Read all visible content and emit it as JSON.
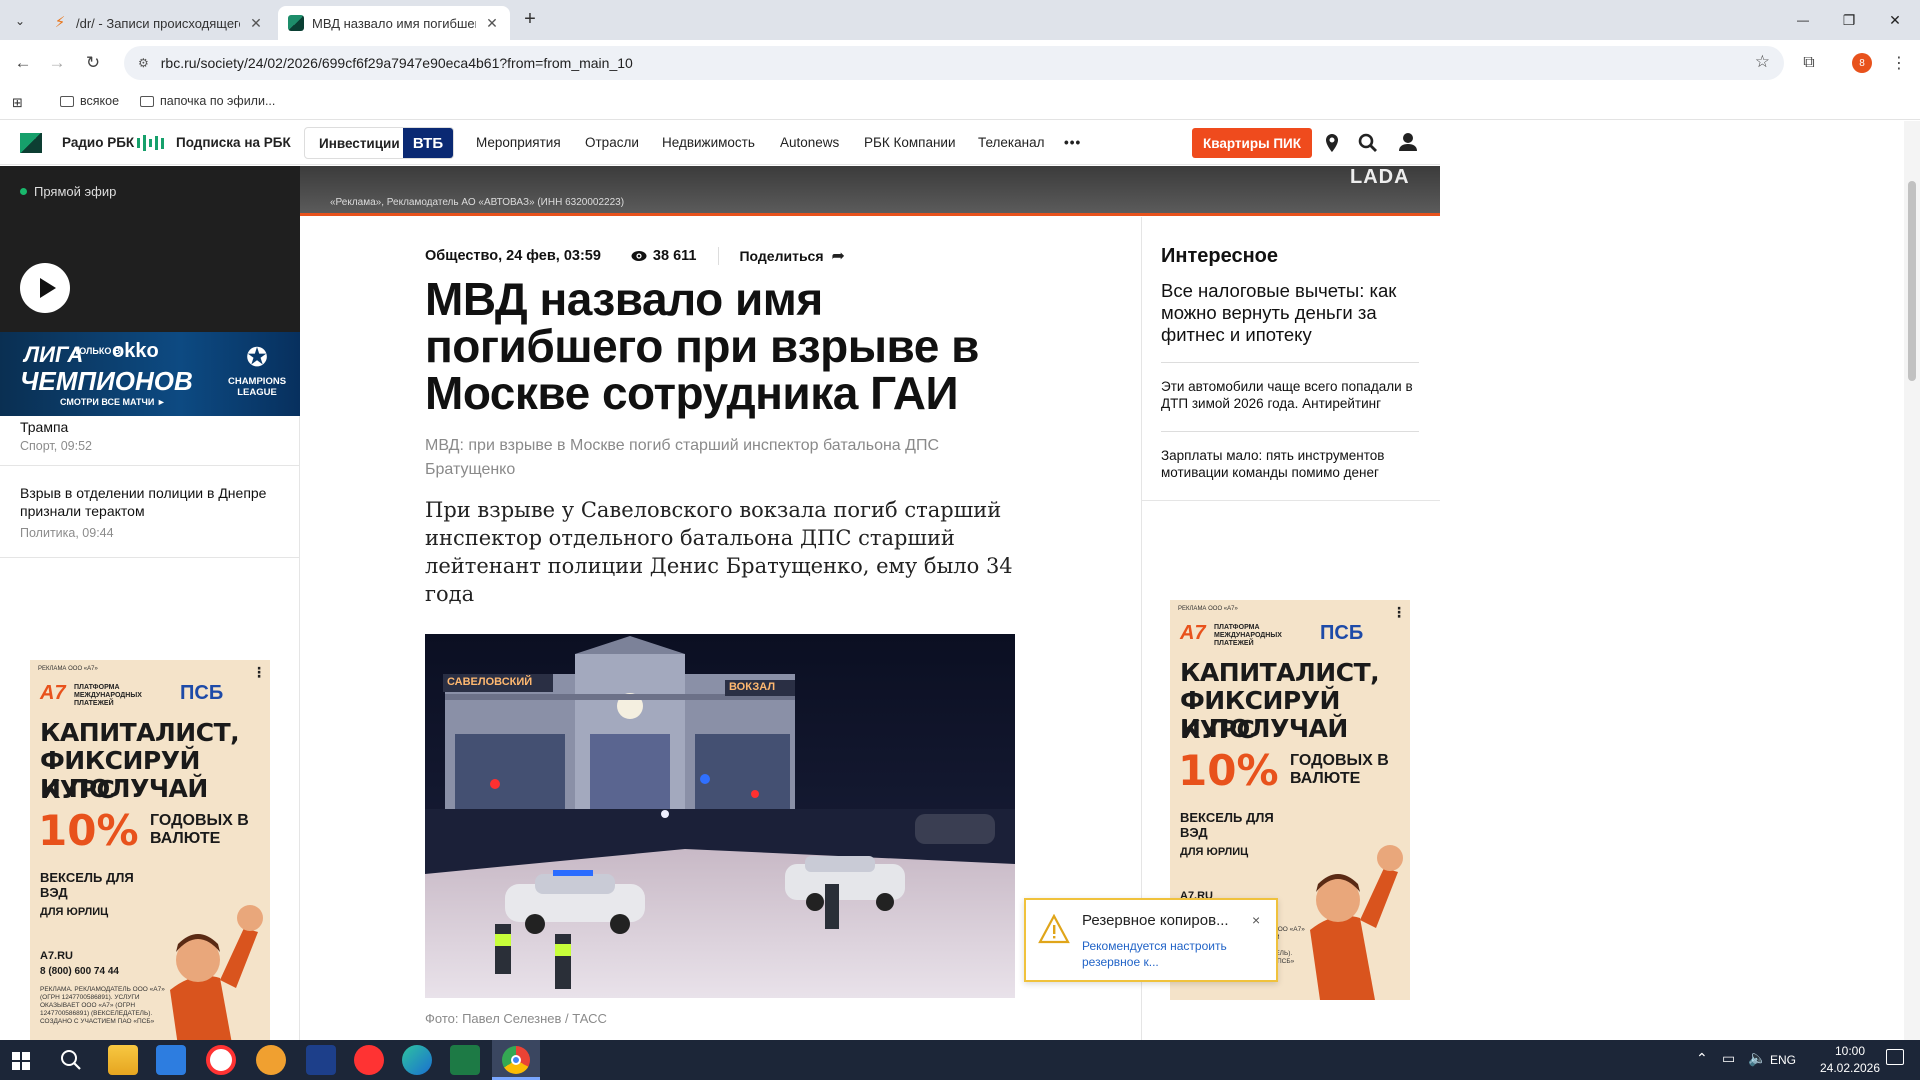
{
  "browser": {
    "tabs": [
      {
        "title": "/dr/ - Записи происходящего",
        "active": false
      },
      {
        "title": "МВД назвало имя погибшего",
        "active": true
      }
    ],
    "new_tab": "+",
    "window_controls": {
      "minimize": "—",
      "restore": "❐",
      "close": "✕"
    },
    "url": "rbc.ru/society/24/02/2026/699cf6f29a7947e90eca4b61?from=from_main_10",
    "profile_initial": "8",
    "bookmarks": [
      "всякое",
      "папочка по эфили..."
    ]
  },
  "site_nav": {
    "radio": "Радио РБК",
    "subscription": "Подписка на РБК",
    "investments": "Инвестиции",
    "vtb": "ВТБ",
    "items": [
      "Мероприятия",
      "Отрасли",
      "Недвижимость",
      "Autonews",
      "РБК Компании",
      "Телеканал"
    ],
    "more": "•••",
    "pik_button": "Квартиры ПИК"
  },
  "top_banner": {
    "disclaimer": "«Реклама», Рекламодатель АО «АВТОВАЗ» (ИНН 6320002223)",
    "brand": "LADA"
  },
  "left_rail": {
    "live_label": "Прямой эфир",
    "okko_banner": {
      "line1": "ЛИГА",
      "line2": "ЧЕМПИОНОВ",
      "only": "ТОЛЬКО В",
      "okko": "okko",
      "watch": "СМОТРИ ВСЕ МАТЧИ ►",
      "ucl": "CHAMPIONS LEAGUE"
    },
    "news": [
      {
        "title": "Трампа",
        "meta": "Спорт, 09:52"
      },
      {
        "title": "Взрыв в отделении полиции в Днепре признали терактом",
        "meta": "Политика, 09:44"
      }
    ]
  },
  "article": {
    "rubric_date": "Общество, 24 фев, 03:59",
    "views": "38 611",
    "share": "Поделиться",
    "title": "МВД назвало имя погибшего при взрыве в Москве сотрудника ГАИ",
    "subtitle": "МВД: при взрыве в Москве погиб старший инспектор батальона ДПС Братущенко",
    "lead": "При взрыве у Савеловского вокзала погиб старший инспектор отдельного батальона ДПС старший лейтенант полиции Денис Братущенко, ему было 34 года",
    "photo_caption": "Фото: Павел Селезнев / ТАСС",
    "photo_signs": {
      "left": "САВЕЛОВСКИЙ",
      "right": "ВОКЗАЛ"
    }
  },
  "right_col": {
    "heading": "Интересное",
    "items": [
      "Все налоговые вычеты: как можно вернуть деньги за фитнес и ипотеку",
      "Эти автомобили чаще всего попадали в ДТП зимой 2026 года. Антирейтинг",
      "Зарплаты мало: пять инструментов мотивации команды помимо денег"
    ]
  },
  "ad_psb": {
    "top_note": "РЕКЛАМА ООО «А7»",
    "a7": "А7",
    "a7_sub": "ПЛАТФОРМА МЕЖДУНАРОДНЫХ ПЛАТЕЖЕЙ",
    "psb": "ПСБ",
    "headline1": "КАПИТАЛИСТ,",
    "headline2": "ФИКСИРУЙ КУРС",
    "headline3": "И ПОЛУЧАЙ",
    "percent": "10%",
    "percent_text": "ГОДОВЫХ В ВАЛЮТЕ",
    "product": "ВЕКСЕЛЬ ДЛЯ ВЭД",
    "audience": "ДЛЯ ЮРЛИЦ",
    "site": "A7.RU",
    "phone": "8 (800) 600 74 44",
    "legal": "РЕКЛАМА. РЕКЛАМОДАТЕЛЬ ООО «А7» (ОГРН 1247700586891). УСЛУГИ ОКАЗЫВАЕТ ООО «А7» (ОГРН 1247700586891) (ВЕКСЕЛЕДАТЕЛЬ). СОЗДАНО С УЧАСТИЕМ ПАО «ПСБ»"
  },
  "notification": {
    "title": "Резервное копиров...",
    "body": "Рекомендуется настроить резервное к...",
    "close": "×"
  },
  "taskbar": {
    "lang": "ENG",
    "time": "10:00",
    "date": "24.02.2026"
  }
}
